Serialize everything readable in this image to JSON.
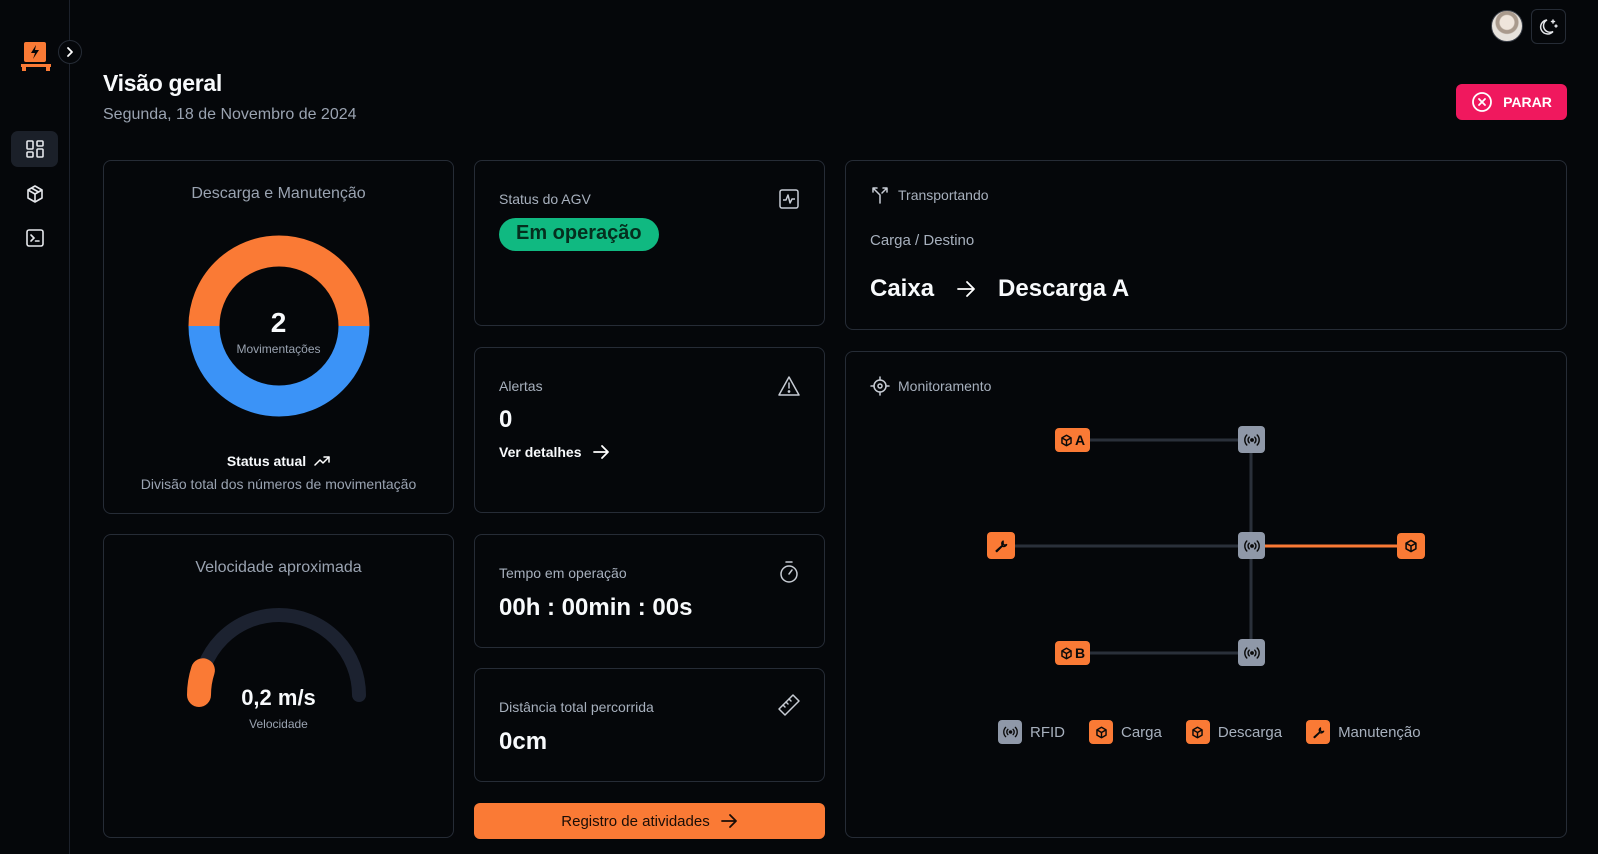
{
  "header": {
    "title": "Visão geral",
    "date": "Segunda, 18 de Novembro de 2024",
    "stop_label": "PARAR"
  },
  "sidebar": {
    "items": [
      {
        "icon": "dashboard-icon",
        "active": true
      },
      {
        "icon": "box-icon",
        "active": false
      },
      {
        "icon": "terminal-icon",
        "active": false
      }
    ]
  },
  "donut": {
    "title": "Descarga e Manutenção",
    "value": "2",
    "value_label": "Movimentações",
    "status_label": "Status atual",
    "footer": "Divisão total dos números de movimentação"
  },
  "speed": {
    "title": "Velocidade aproximada",
    "value": "0,2 m/s",
    "value_label": "Velocidade",
    "fraction": 0.1
  },
  "status": {
    "label": "Status do AGV",
    "badge": "Em operação"
  },
  "alerts": {
    "label": "Alertas",
    "count": "0",
    "details_link": "Ver detalhes"
  },
  "time": {
    "label": "Tempo em operação",
    "value": "00h : 00min : 00s"
  },
  "distance": {
    "label": "Distância total percorrida",
    "value": "0cm"
  },
  "activity_button": "Registro de atividades",
  "transport": {
    "label": "Transportando",
    "sublabel": "Carga / Destino",
    "cargo": "Caixa",
    "destination": "Descarga A"
  },
  "monitor": {
    "label": "Monitoramento",
    "node_a": "A",
    "node_b": "B",
    "legend": [
      "RFID",
      "Carga",
      "Descarga",
      "Manutenção"
    ]
  },
  "colors": {
    "accent": "#fa7a35",
    "blue": "#3b93f7",
    "danger": "#f0185e",
    "success": "#10b981"
  },
  "chart_data": {
    "type": "pie",
    "categories": [
      "Descarga",
      "Manutenção"
    ],
    "values": [
      1,
      1
    ],
    "colors": [
      "#fa7a35",
      "#3b93f7"
    ],
    "title": "Descarga e Manutenção"
  }
}
